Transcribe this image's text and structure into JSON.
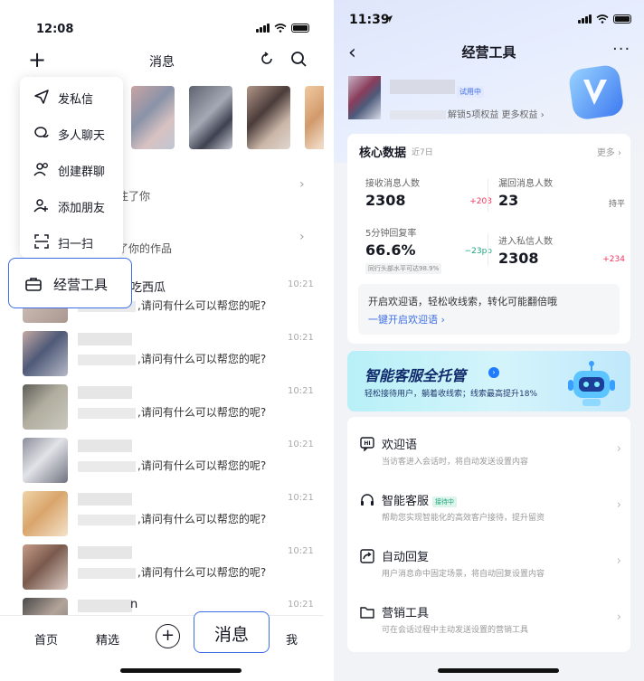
{
  "left": {
    "status_time": "12:08",
    "header_title": "消息",
    "notify_rows": [
      {
        "text": "注了你"
      },
      {
        "text": "了你的作品"
      }
    ],
    "popup_items": [
      {
        "label": "发私信",
        "icon": "send-icon"
      },
      {
        "label": "多人聊天",
        "icon": "group-chat-icon"
      },
      {
        "label": "创建群聊",
        "icon": "create-group-icon"
      },
      {
        "label": "添加朋友",
        "icon": "add-friend-icon"
      },
      {
        "label": "扫一扫",
        "icon": "scan-icon"
      }
    ],
    "biz_tool_label": "经营工具",
    "first_chat_name": "吃西瓜",
    "chats": [
      {
        "msg": ",请问有什么可以帮您的呢?",
        "time": "10:21"
      },
      {
        "msg": ",请问有什么可以帮您的呢?",
        "time": "10:21"
      },
      {
        "msg": ",请问有什么可以帮您的呢?",
        "time": "10:21"
      },
      {
        "msg": ",请问有什么可以帮您的呢?",
        "time": "10:21"
      },
      {
        "msg": ",请问有什么可以帮您的呢?",
        "time": "10:21"
      },
      {
        "msg": ",请问有什么可以帮您的呢?",
        "time": "10:21"
      }
    ],
    "last_row": {
      "name_tail": "n",
      "time": "10:21"
    },
    "tabs": {
      "home": "首页",
      "featured": "精选",
      "messages": "消息",
      "me": "我"
    }
  },
  "right": {
    "status_time": "11:39",
    "title": "经营工具",
    "more": "···",
    "trial_badge": "试用中",
    "profile_sub": "解锁5项权益  更多权益 ›",
    "core": {
      "title": "核心数据",
      "period": "近7日",
      "more": "更多 ›",
      "metrics": [
        {
          "label": "接收消息人数",
          "value": "2308",
          "delta": "+203",
          "delta_color": "#f0365f"
        },
        {
          "label": "漏回消息人数",
          "value": "23",
          "delta": "持平",
          "delta_color": "#666666"
        },
        {
          "label": "5分钟回复率",
          "value": "66.6%",
          "delta": "−23pp",
          "delta_color": "#1aa37a",
          "note": "同行头部水平可达98.9%"
        },
        {
          "label": "进入私信人数",
          "value": "2308",
          "delta": "+234",
          "delta_color": "#f0365f"
        }
      ],
      "welcome_text": "开启欢迎语，轻松收线索，转化可能翻倍哦",
      "welcome_link": "一键开启欢迎语 ›"
    },
    "banner": {
      "title": "智能客服全托管",
      "subtitle": "轻松接待用户，躺着收线索；线索最高提升18%"
    },
    "features": [
      {
        "title": "欢迎语",
        "desc": "当访客进入会话时，将自动发送设置内容",
        "icon": "hi-bubble-icon"
      },
      {
        "title": "智能客服",
        "badge": "接待中",
        "desc": "帮助您实现智能化的高效客户接待，提升留资",
        "icon": "headset-icon"
      },
      {
        "title": "自动回复",
        "desc": "用户消息命中固定场景，将自动回复设置内容",
        "icon": "auto-reply-icon"
      },
      {
        "title": "营销工具",
        "desc": "可在会话过程中主动发送设置的营销工具",
        "icon": "folder-icon"
      }
    ]
  },
  "colors": {
    "accent": "#3e6fe6",
    "up": "#f0365f",
    "down": "#1aa37a"
  }
}
